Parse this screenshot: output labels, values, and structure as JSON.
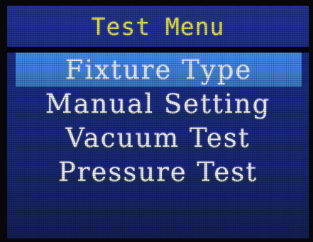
{
  "title": "Test Menu",
  "menu": {
    "items": [
      {
        "label": "Fixture Type",
        "selected": true
      },
      {
        "label": "Manual Setting",
        "selected": false
      },
      {
        "label": "Vacuum Test",
        "selected": false
      },
      {
        "label": "Pressure Test",
        "selected": false
      }
    ]
  },
  "colors": {
    "screen_background": "#1b2f86",
    "title_text": "#e8e64a",
    "selection_highlight": "#4a8ee8",
    "menu_text": "#f4f4f4"
  }
}
